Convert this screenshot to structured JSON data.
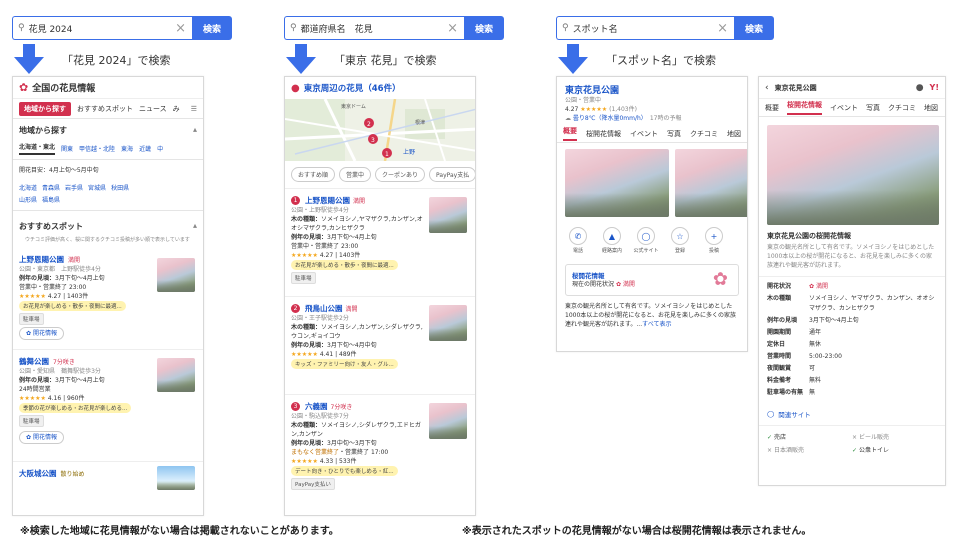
{
  "searches": [
    {
      "query": "花見 2024",
      "button": "検索",
      "caption": "「花見 2024」で検索"
    },
    {
      "query": "都道府県名　花見",
      "button": "検索",
      "caption": "「東京 花見」で検索"
    },
    {
      "query": "スポット名",
      "button": "検索",
      "caption": "「スポット名」で検索"
    }
  ],
  "panel1": {
    "title": "全国の花見情報",
    "tabs": [
      "地域から探す",
      "おすすめスポット",
      "ニュース",
      "み"
    ],
    "region_head": "地域から探す",
    "regions": [
      "北海道・東北",
      "関東",
      "甲信越・北陸",
      "東海",
      "近畿",
      "中"
    ],
    "bloom_forecast": "開花目安：4月上旬〜5月中旬",
    "prefectures_row1": [
      "北海道",
      "青森県",
      "岩手県",
      "宮城県",
      "秋田県"
    ],
    "prefectures_row2": [
      "山形県",
      "福島県"
    ],
    "recommend_head": "おすすめスポット",
    "recommend_note": "ウチコミ評価が高く、桜に関するクチコミ投稿が多い順で表示しています",
    "spots": [
      {
        "name": "上野恩賜公園",
        "status": "満開",
        "pref": "公園",
        "area": "東京都",
        "station": "上野駅徒歩4分",
        "period_label": "例年の見頃：",
        "period": "3月下旬〜4月上旬",
        "hours_status": "営業中",
        "hours": "営業終了 23:00",
        "rating": "4.27",
        "reviews": "1403件",
        "tag": "お花見が楽しめる・散歩・夜間に最適...",
        "chip": "駐車場",
        "btn": "開花情報"
      },
      {
        "name": "鶴舞公園",
        "status": "7分咲き",
        "pref": "公園",
        "area": "愛知県",
        "station": "鶴舞駅徒歩3分",
        "period_label": "例年の見頃：",
        "period": "3月下旬〜4月上旬",
        "hours_status": "24時間営業",
        "hours": "",
        "rating": "4.16",
        "reviews": "960件",
        "tag": "季節の花が楽しめる・お花見が楽しめる...",
        "chip": "駐車場",
        "btn": "開花情報"
      },
      {
        "name": "大阪城公園",
        "status": "散り始め"
      }
    ]
  },
  "panel2": {
    "title": "東京周辺の花見（46件）",
    "filters": [
      "おすすめ順",
      "営業中",
      "クーポンあり",
      "PayPay支払"
    ],
    "spots": [
      {
        "no": "1",
        "name": "上野恩賜公園",
        "status": "満開",
        "pref": "公園",
        "station": "上野駅徒歩4分",
        "variety_label": "木の種類：",
        "varieties": "ソメイヨシノ,ヤマザクラ,カンザン,オオシマザクラ,カンヒザクラ",
        "period_label": "例年の見頃：",
        "period": "3月下旬〜4月上旬",
        "hours_status": "営業中",
        "hours": "営業終了 23:00",
        "rating": "4.27",
        "reviews": "1403件",
        "tag": "お花見が楽しめる・散歩・夜間に最適...",
        "chip": "駐車場"
      },
      {
        "no": "2",
        "name": "飛鳥山公園",
        "status": "満開",
        "pref": "公園",
        "station": "王子駅徒歩2分",
        "variety_label": "木の種類：",
        "varieties": "ソメイヨシノ,カンザン,シダレザクラ,ウコン,ギョイコウ",
        "period_label": "例年の見頃：",
        "period": "3月下旬〜4月中旬",
        "hours_status": "",
        "hours": "",
        "rating": "4.41",
        "reviews": "489件",
        "tag": "キッズ・ファミリー向け・友人・グル...",
        "chip": ""
      },
      {
        "no": "3",
        "name": "六義園",
        "status": "7分咲き",
        "pref": "公園",
        "station": "駒込駅徒歩7分",
        "variety_label": "木の種類：",
        "varieties": "ソメイヨシノ,シダレザクラ,エドヒガン,カンザン",
        "period_label": "例年の見頃：",
        "period": "3月中旬〜3月下旬",
        "hours_status": "まもなく営業終了",
        "hours": "営業終了 17:00",
        "rating": "4.33",
        "reviews": "533件",
        "tag": "デート向き・ひとりでも楽しめる・紅...",
        "chip": "PayPay支払い"
      }
    ],
    "map_labels": [
      "上野",
      "東京ドーム",
      "根津"
    ]
  },
  "panel3": {
    "name": "東京花見公園",
    "category": "公園",
    "status": "営業中",
    "rating": "4.27",
    "reviews": "(1,403件)",
    "weather": "曇り8℃（降水量0mm/h）",
    "forecast": "17時の予報",
    "tabs": [
      "概要",
      "桜開花情報",
      "イベント",
      "写真",
      "クチコミ",
      "地図"
    ],
    "actions": [
      "電話",
      "経路案内",
      "公式サイト",
      "登録",
      "投稿"
    ],
    "bloom_title": "桜開花情報",
    "bloom_status_label": "現在の開花状況",
    "bloom_status": "満開",
    "desc": "東京の観光名所として有名です。ソメイヨシノをはじめとした1000本以上の桜が開花になると、お花見を楽しみに多くの家族連れや観光客が訪れます。...",
    "more": "すべて表示"
  },
  "panel4": {
    "title": "東京花見公園",
    "tabs": [
      "概要",
      "桜開花情報",
      "イベント",
      "写真",
      "クチコミ",
      "地図"
    ],
    "section_title": "東京花見公園の桜開花情報",
    "desc": "東京の観光名所として有名です。ソメイヨシノをはじめとした1000本以上の桜が開花になると、お花見を楽しみに多くの家族連れや観光客が訪れます。",
    "rows": [
      {
        "k": "開花状況",
        "v": "満開"
      },
      {
        "k": "木の種類",
        "v": "ソメイヨシノ、ヤマザクラ、カンザン、オオシマザクラ、カンヒザクラ"
      },
      {
        "k": "例年の見頃",
        "v": "3月下旬〜4月上旬"
      },
      {
        "k": "開園期間",
        "v": "通年"
      },
      {
        "k": "定休日",
        "v": "無休"
      },
      {
        "k": "営業時間",
        "v": "5:00-23:00"
      },
      {
        "k": "夜間観賞",
        "v": "可"
      },
      {
        "k": "料金備考",
        "v": "無料"
      },
      {
        "k": "駐車場の有無",
        "v": "無"
      }
    ],
    "related": "関連サイト",
    "facilities": [
      {
        "ok": true,
        "label": "売店"
      },
      {
        "ok": false,
        "label": "ビール販売"
      },
      {
        "ok": false,
        "label": "日本酒販売"
      },
      {
        "ok": true,
        "label": "公衆トイレ"
      }
    ]
  },
  "notes": [
    "※検索した地域に花見情報がない場合は掲載されないことがあります。",
    "※表示されたスポットの花見情報がない場合は桜開花情報は表示されません。"
  ],
  "colors": {
    "accent": "#3a6ee8",
    "pink": "#d2304e",
    "link": "#1a55c8"
  }
}
